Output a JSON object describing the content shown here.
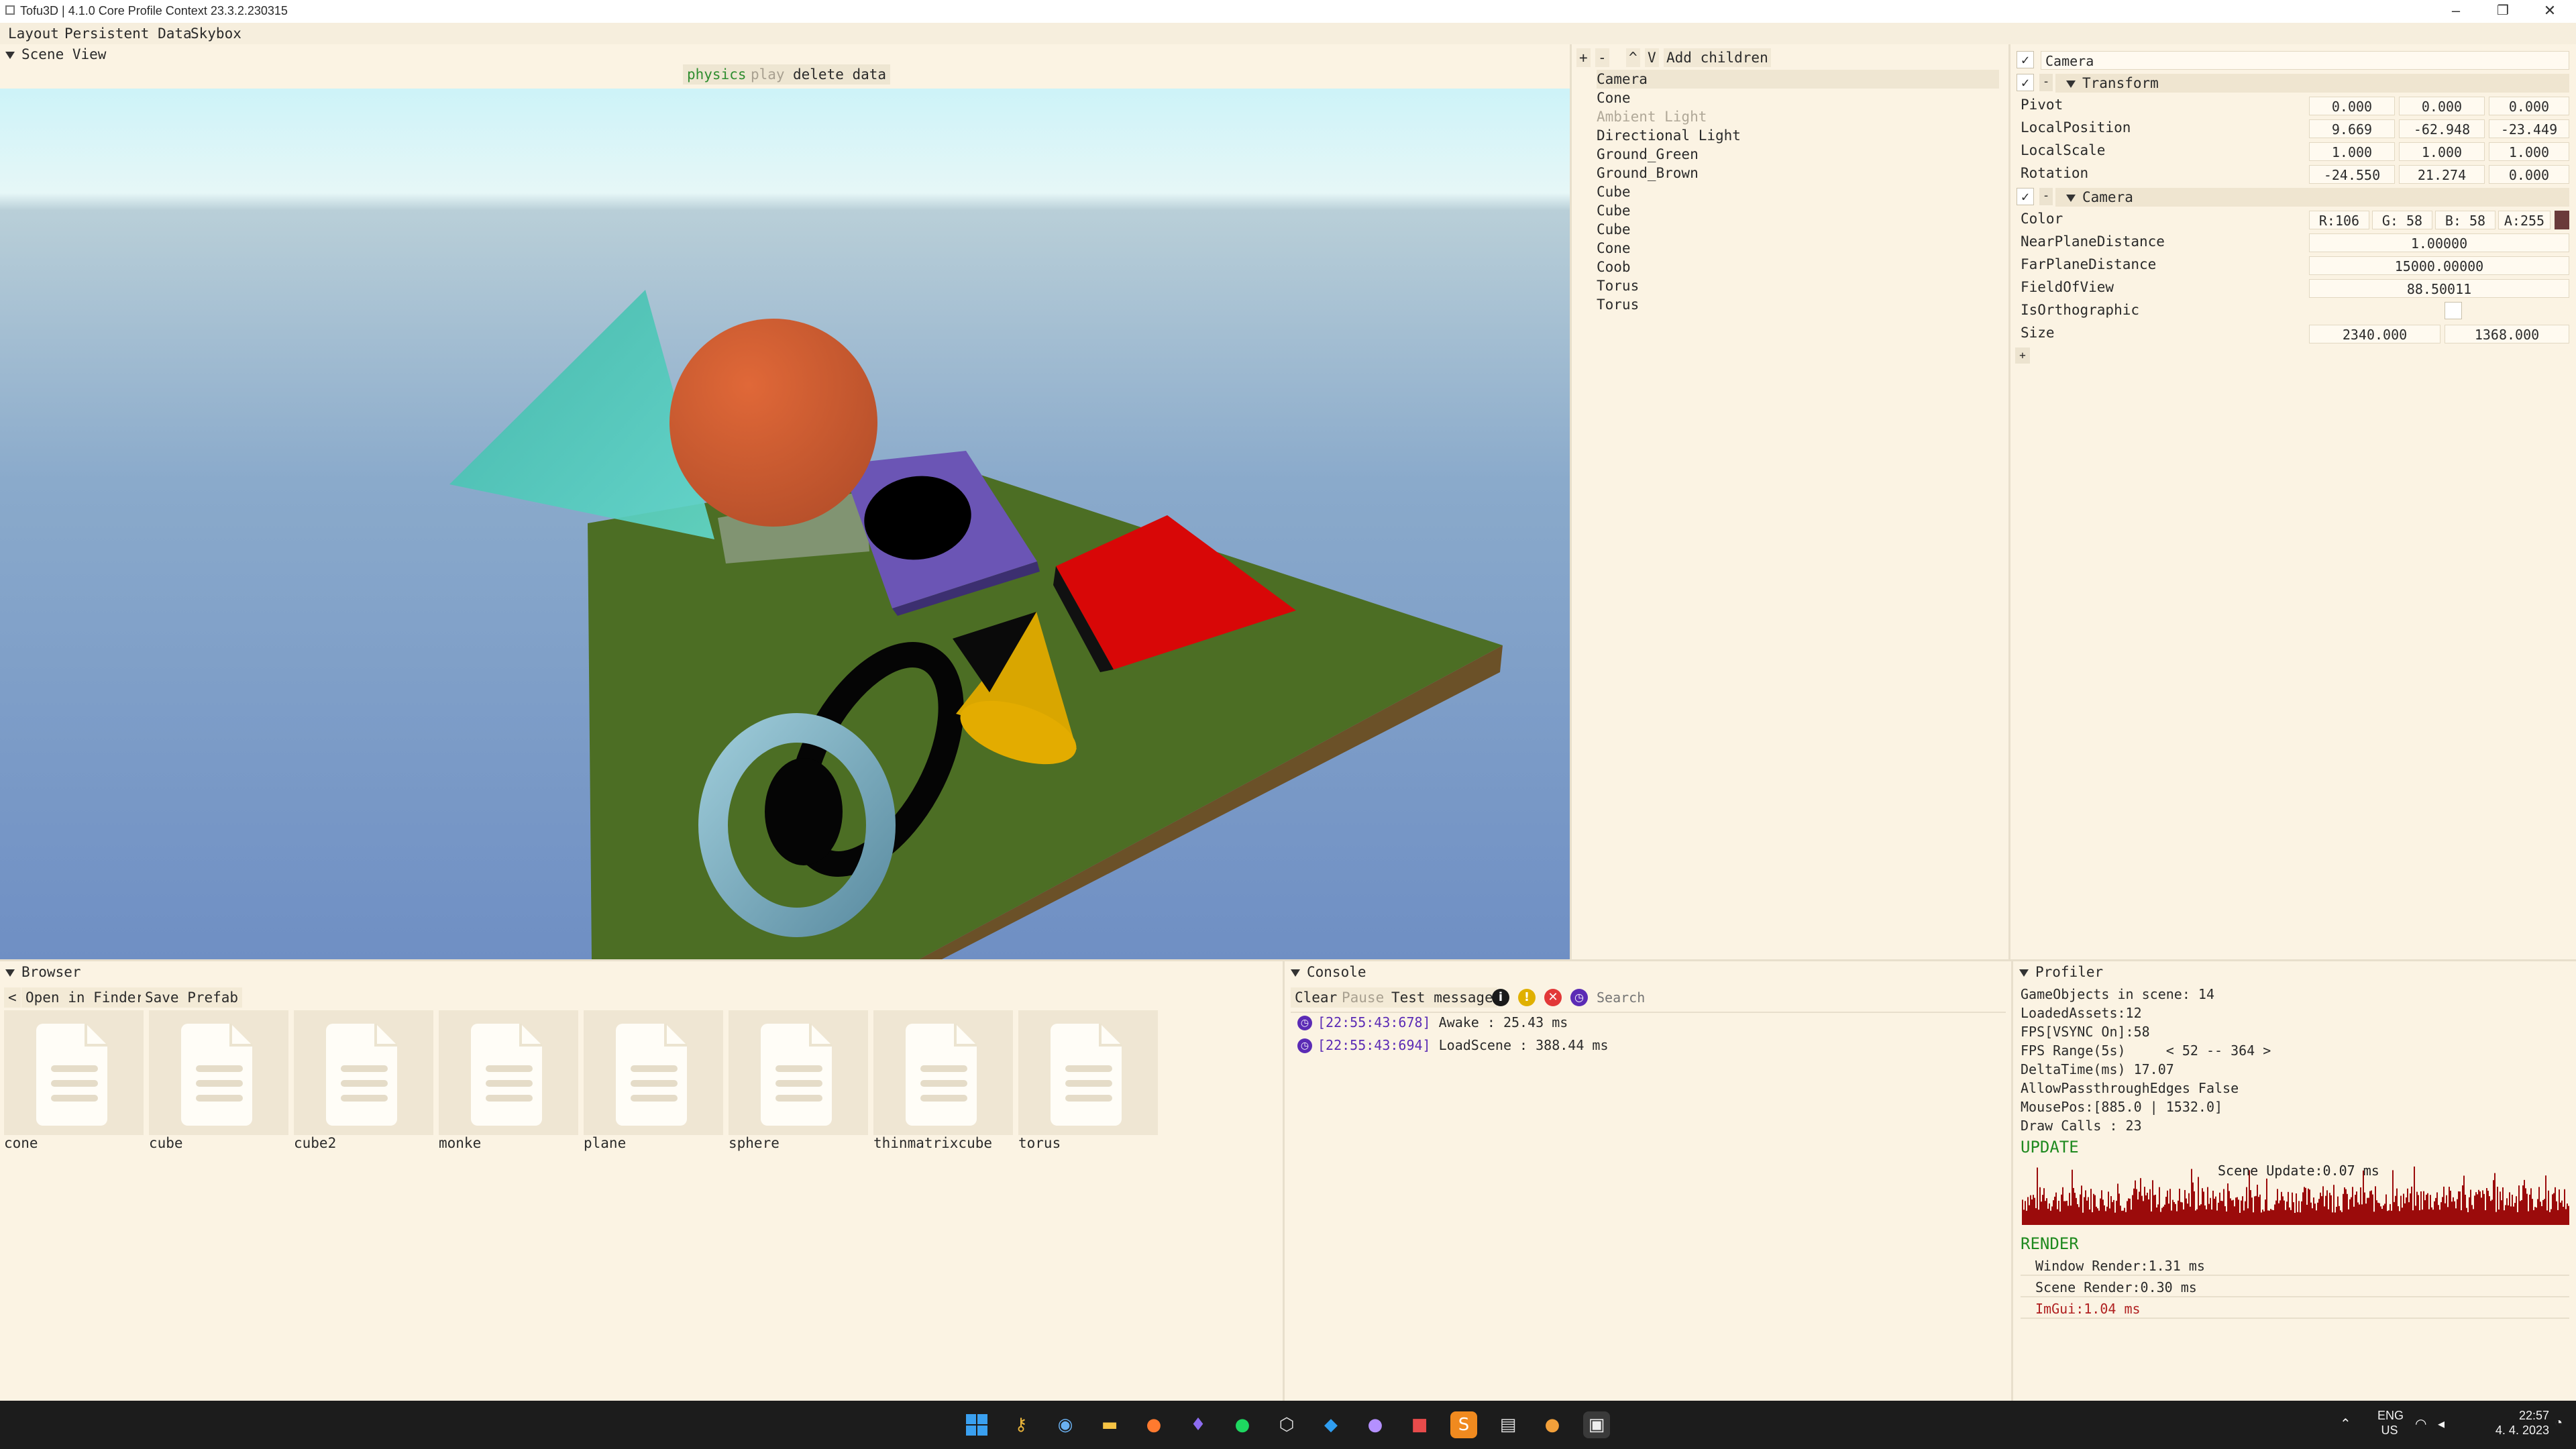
{
  "window": {
    "title": "Tofu3D | 4.1.0 Core Profile Context 23.3.2.230315",
    "minimize": "–",
    "maximize": "❐",
    "close": "✕"
  },
  "menu": [
    "Layout",
    "Persistent Data",
    "Skybox"
  ],
  "scene_view": {
    "title": "Scene View",
    "physics_label": "physics",
    "play_label": "play",
    "delete_label": "delete data"
  },
  "hierarchy": {
    "tools": [
      "+",
      "-",
      "^",
      "V",
      "Add children"
    ],
    "items": [
      {
        "name": "Camera",
        "selected": true,
        "disabled": false
      },
      {
        "name": "Cone",
        "selected": false,
        "disabled": false
      },
      {
        "name": "Ambient Light",
        "selected": false,
        "disabled": true
      },
      {
        "name": "Directional Light",
        "selected": false,
        "disabled": false
      },
      {
        "name": "Ground_Green",
        "selected": false,
        "disabled": false
      },
      {
        "name": "Ground_Brown",
        "selected": false,
        "disabled": false
      },
      {
        "name": "Cube",
        "selected": false,
        "disabled": false
      },
      {
        "name": "Cube",
        "selected": false,
        "disabled": false
      },
      {
        "name": "Cube",
        "selected": false,
        "disabled": false
      },
      {
        "name": "Cone",
        "selected": false,
        "disabled": false
      },
      {
        "name": "Coob",
        "selected": false,
        "disabled": false
      },
      {
        "name": "Torus",
        "selected": false,
        "disabled": false
      },
      {
        "name": "Torus",
        "selected": false,
        "disabled": false
      }
    ]
  },
  "inspector": {
    "object_name": "Camera",
    "transform": {
      "header": "Transform",
      "pivot_label": "Pivot",
      "pivot": [
        "0.000",
        "0.000",
        "0.000"
      ],
      "local_position_label": "LocalPosition",
      "local_position": [
        "9.669",
        "-62.948",
        "-23.449"
      ],
      "local_scale_label": "LocalScale",
      "local_scale": [
        "1.000",
        "1.000",
        "1.000"
      ],
      "rotation_label": "Rotation",
      "rotation": [
        "-24.550",
        "21.274",
        "0.000"
      ]
    },
    "camera": {
      "header": "Camera",
      "color_label": "Color",
      "color": [
        "R:106",
        "G: 58",
        "B: 58",
        "A:255"
      ],
      "color_swatch": "#6a3a3a",
      "near_label": "NearPlaneDistance",
      "near": "1.00000",
      "far_label": "FarPlaneDistance",
      "far": "15000.00000",
      "fov_label": "FieldOfView",
      "fov": "88.50011",
      "ortho_label": "IsOrthographic",
      "size_label": "Size",
      "size": [
        "2340.000",
        "1368.000"
      ]
    },
    "add_component": "+"
  },
  "browser": {
    "title": "Browser",
    "back": "<",
    "open_finder": "Open in Finder",
    "save_prefab": "Save Prefab",
    "files": [
      "cone",
      "cube",
      "cube2",
      "monke",
      "plane",
      "sphere",
      "thinmatrixcube",
      "torus"
    ]
  },
  "console": {
    "title": "Console",
    "clear": "Clear",
    "pause": "Pause",
    "test_message": "Test message",
    "search_placeholder": "Search",
    "logs": [
      {
        "time": "[22:55:43:678]",
        "text": "Awake : 25.43 ms"
      },
      {
        "time": "[22:55:43:694]",
        "text": "LoadScene : 388.44 ms"
      }
    ]
  },
  "profiler": {
    "title": "Profiler",
    "lines": [
      "GameObjects in scene: 14",
      "LoadedAssets:12",
      "FPS[VSYNC On]:58",
      "FPS Range(5s)     < 52 -- 364 >",
      "DeltaTime(ms) 17.07",
      "AllowPassthroughEdges False",
      "MousePos:[885.0 | 1532.0]",
      "Draw Calls : 23"
    ],
    "update_label": "UPDATE",
    "graph_label": "Scene Update:0.07 ms",
    "render_label": "RENDER",
    "render_items": [
      "Window Render:1.31 ms",
      "Scene Render:0.30 ms",
      "ImGui:1.04 ms"
    ]
  },
  "taskbar": {
    "lang": "ENG",
    "region": "US",
    "time": "22:57",
    "date": "4. 4. 2023"
  }
}
